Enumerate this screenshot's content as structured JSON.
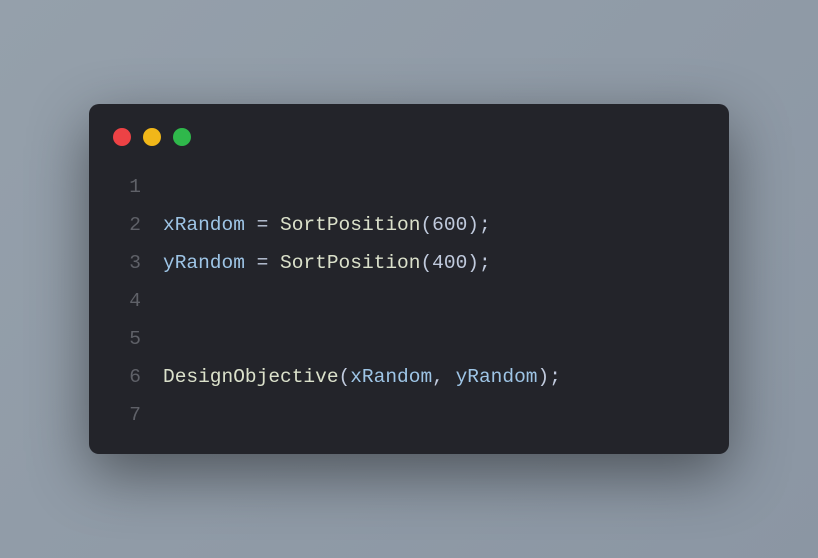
{
  "windowButtons": {
    "red": "close",
    "yellow": "minimize",
    "green": "maximize"
  },
  "lineNumbers": [
    "1",
    "2",
    "3",
    "4",
    "5",
    "6",
    "7"
  ],
  "code": {
    "line2": {
      "var": "xRandom",
      "eq": " = ",
      "func": "SortPosition",
      "lparen": "(",
      "arg": "600",
      "rparen": ")",
      "semi": ";"
    },
    "line3": {
      "var": "yRandom",
      "eq": " = ",
      "func": "SortPosition",
      "lparen": "(",
      "arg": "400",
      "rparen": ")",
      "semi": ";"
    },
    "line6": {
      "func": "DesignObjective",
      "lparen": "(",
      "arg1": "xRandom",
      "comma": ", ",
      "arg2": "yRandom",
      "rparen": ")",
      "semi": ";"
    }
  }
}
